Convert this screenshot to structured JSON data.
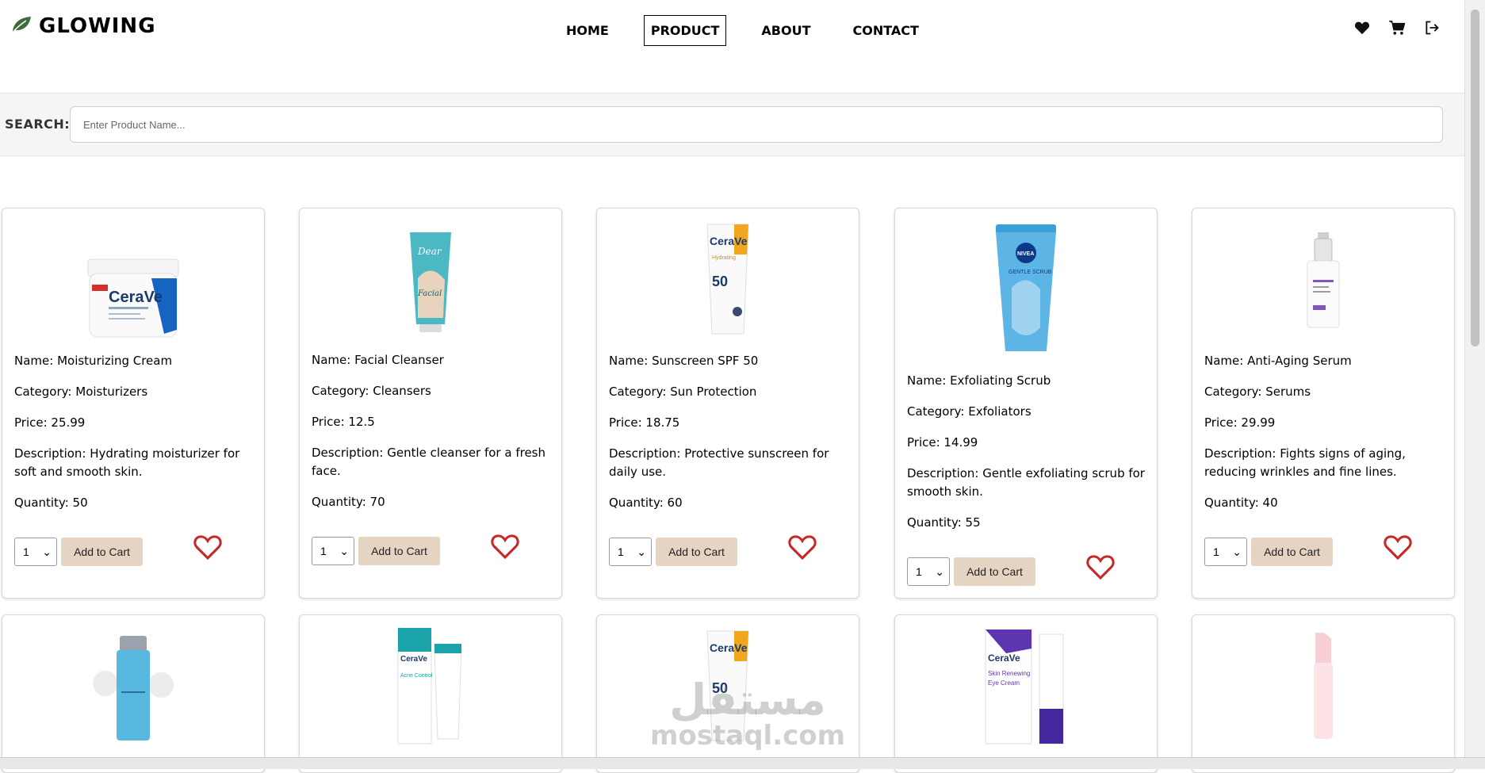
{
  "header": {
    "logo_text": "GLOWING",
    "nav": [
      {
        "label": "HOME",
        "active": false
      },
      {
        "label": "PRODUCT",
        "active": true
      },
      {
        "label": "ABOUT",
        "active": false
      },
      {
        "label": "CONTACT",
        "active": false
      }
    ],
    "icons": [
      "heart-icon",
      "cart-icon",
      "logout-icon"
    ]
  },
  "search": {
    "label": "SEARCH:",
    "placeholder": "Enter Product Name..."
  },
  "products": [
    {
      "name": "Name: Moisturizing Cream",
      "category": "Category: Moisturizers",
      "price": "Price: 25.99",
      "description": "Description: Hydrating moisturizer for soft and smooth skin.",
      "quantity": "Quantity: 50",
      "qty_selected": "1",
      "add_label": "Add to Cart",
      "image": "cream-jar"
    },
    {
      "name": "Name: Facial Cleanser",
      "category": "Category: Cleansers",
      "price": "Price: 12.5",
      "description": "Description: Gentle cleanser for a fresh face.",
      "quantity": "Quantity: 70",
      "qty_selected": "1",
      "add_label": "Add to Cart",
      "image": "cleanser-tube"
    },
    {
      "name": "Name: Sunscreen SPF 50",
      "category": "Category: Sun Protection",
      "price": "Price: 18.75",
      "description": "Description: Protective sunscreen for daily use.",
      "quantity": "Quantity: 60",
      "qty_selected": "1",
      "add_label": "Add to Cart",
      "image": "sunscreen-tube"
    },
    {
      "name": "Name: Exfoliating Scrub",
      "category": "Category: Exfoliators",
      "price": "Price: 14.99",
      "description": "Description: Gentle exfoliating scrub for smooth skin.",
      "quantity": "Quantity: 55",
      "qty_selected": "1",
      "add_label": "Add to Cart",
      "image": "scrub-tube"
    },
    {
      "name": "Name: Anti-Aging Serum",
      "category": "Category: Serums",
      "price": "Price: 29.99",
      "description": "Description: Fights signs of aging, reducing wrinkles and fine lines.",
      "quantity": "Quantity: 40",
      "qty_selected": "1",
      "add_label": "Add to Cart",
      "image": "serum-bottle"
    }
  ],
  "watermark": {
    "arabic": "مستقل",
    "latin": "mostaql.com"
  },
  "colors": {
    "button_bg": "#e6d4c3",
    "heart": "#c62828",
    "logo_leaf": "#3d6b3d"
  }
}
